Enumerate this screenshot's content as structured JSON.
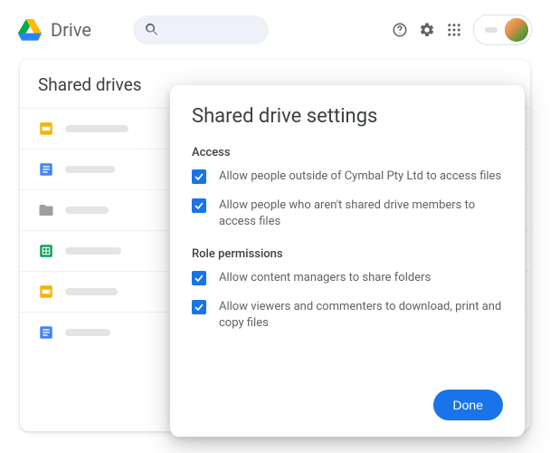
{
  "product": "Drive",
  "panel": {
    "title": "Shared drives"
  },
  "list_items": [
    {
      "type": "slides"
    },
    {
      "type": "docs"
    },
    {
      "type": "folder"
    },
    {
      "type": "sheets"
    },
    {
      "type": "slides"
    },
    {
      "type": "docs"
    }
  ],
  "dialog": {
    "title": "Shared drive settings",
    "section_access": "Access",
    "access_options": [
      "Allow people outside of Cymbal Pty Ltd to access files",
      "Allow people who aren't shared drive members to access files"
    ],
    "section_roles": "Role permissions",
    "role_options": [
      "Allow content managers to share folders",
      "Allow viewers and commenters to download, print and copy files"
    ],
    "done_label": "Done"
  }
}
